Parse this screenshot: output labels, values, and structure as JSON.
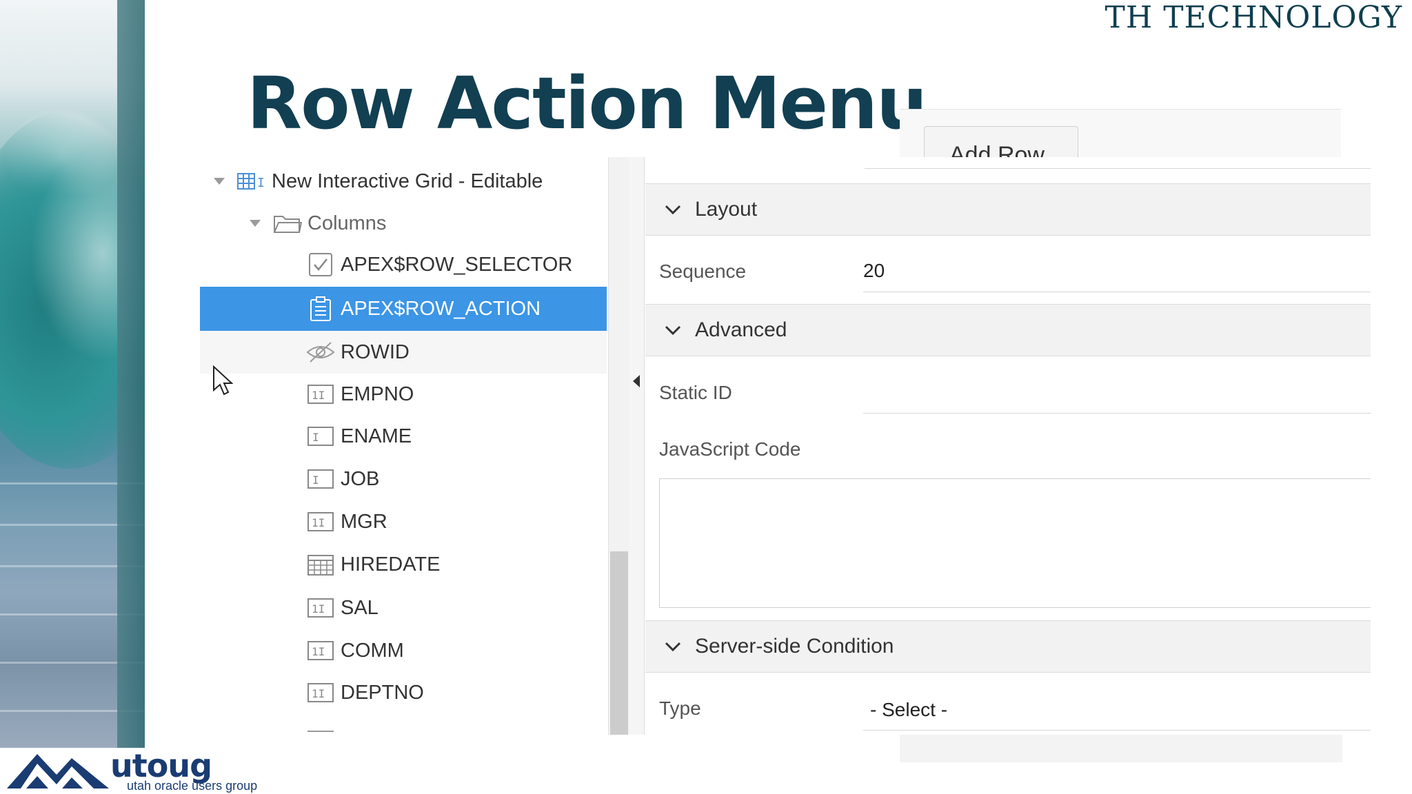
{
  "brand": {
    "prefix": "TH T",
    "rest": "ECHNOLOGY"
  },
  "slide_title": "Row Action Menu",
  "ghost_button": "Add Row",
  "tree": {
    "root_label": "New Interactive Grid - Editable",
    "folder_label": "Columns",
    "items": [
      {
        "label": "APEX$ROW_SELECTOR",
        "icon": "checkbox-icon",
        "selected": false
      },
      {
        "label": "APEX$ROW_ACTION",
        "icon": "clipboard-icon",
        "selected": true
      },
      {
        "label": "ROWID",
        "icon": "hidden-eye-icon",
        "selected": false
      },
      {
        "label": "EMPNO",
        "icon": "number-field-icon",
        "selected": false
      },
      {
        "label": "ENAME",
        "icon": "text-field-icon",
        "selected": false
      },
      {
        "label": "JOB",
        "icon": "text-field-icon",
        "selected": false
      },
      {
        "label": "MGR",
        "icon": "number-field-icon",
        "selected": false
      },
      {
        "label": "HIREDATE",
        "icon": "calendar-icon",
        "selected": false
      },
      {
        "label": "SAL",
        "icon": "number-field-icon",
        "selected": false
      },
      {
        "label": "COMM",
        "icon": "number-field-icon",
        "selected": false
      },
      {
        "label": "DEPTNO",
        "icon": "number-field-icon",
        "selected": false
      }
    ]
  },
  "props": {
    "layout_group": "Layout",
    "sequence_label": "Sequence",
    "sequence_value": "20",
    "advanced_group": "Advanced",
    "static_id_label": "Static ID",
    "static_id_value": "",
    "js_code_label": "JavaScript Code",
    "server_group": "Server-side Condition",
    "type_label": "Type",
    "type_value": "- Select -"
  },
  "logo": {
    "word": "utoug",
    "sub": "utah oracle users group"
  },
  "colors": {
    "selection": "#3c95e5",
    "title": "#123f52",
    "logo": "#1a3c72"
  }
}
